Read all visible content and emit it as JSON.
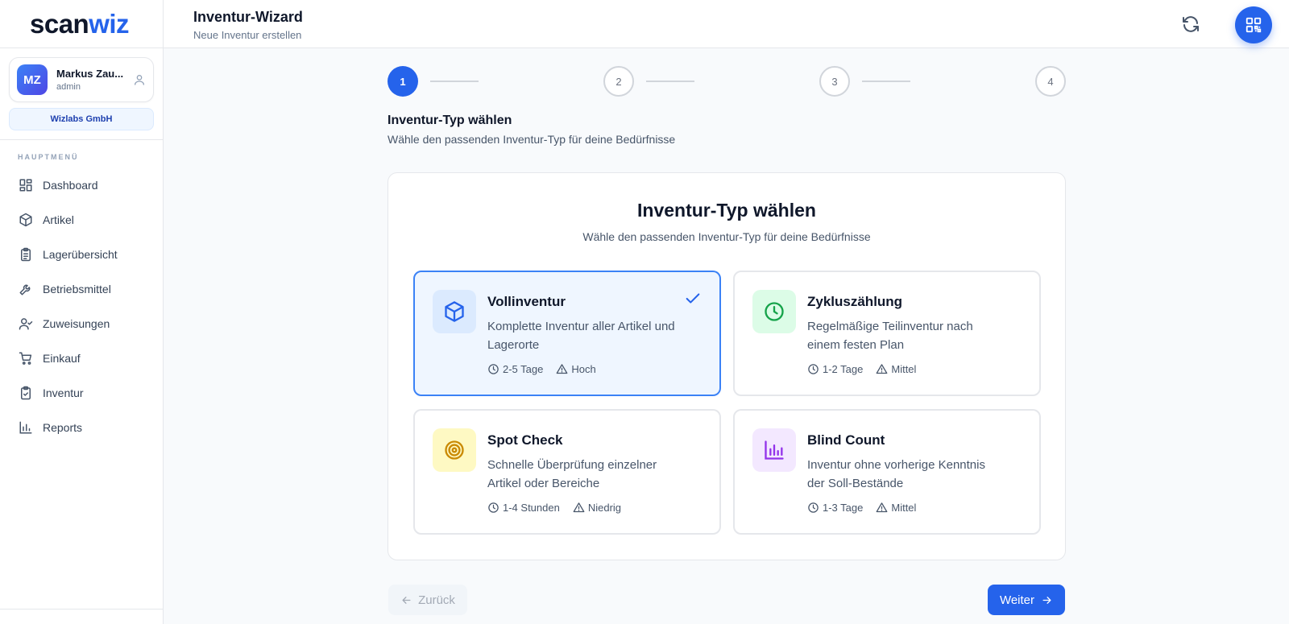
{
  "brand": {
    "logo_part1": "scan",
    "logo_part2": "wiz"
  },
  "user": {
    "initials": "MZ",
    "name": "Markus Zau...",
    "role": "admin",
    "company": "Wizlabs GmbH"
  },
  "sidebar": {
    "heading": "HAUPTMENÜ",
    "items": [
      {
        "label": "Dashboard",
        "icon": "dashboard-icon"
      },
      {
        "label": "Artikel",
        "icon": "package-icon"
      },
      {
        "label": "Lagerübersicht",
        "icon": "clipboard-list-icon"
      },
      {
        "label": "Betriebsmittel",
        "icon": "wrench-icon"
      },
      {
        "label": "Zuweisungen",
        "icon": "user-check-icon"
      },
      {
        "label": "Einkauf",
        "icon": "cart-icon"
      },
      {
        "label": "Inventur",
        "icon": "clipboard-check-icon"
      },
      {
        "label": "Reports",
        "icon": "bar-chart-icon"
      }
    ]
  },
  "header": {
    "title": "Inventur-Wizard",
    "subtitle": "Neue Inventur erstellen"
  },
  "stepper": {
    "steps": [
      "1",
      "2",
      "3",
      "4"
    ],
    "current": 1
  },
  "section": {
    "title": "Inventur-Typ wählen",
    "subtitle": "Wähle den passenden Inventur-Typ für deine Bedürfnisse"
  },
  "card": {
    "title": "Inventur-Typ wählen",
    "subtitle": "Wähle den passenden Inventur-Typ für deine Bedürfnisse",
    "options": [
      {
        "title": "Vollinventur",
        "desc": "Komplette Inventur aller Artikel und Lagerorte",
        "duration": "2-5 Tage",
        "effort": "Hoch",
        "icon": "package-icon",
        "color": "#2563eb",
        "bg": "#dbeafe",
        "selected": true
      },
      {
        "title": "Zykluszählung",
        "desc": "Regelmäßige Teilinventur nach einem festen Plan",
        "duration": "1-2 Tage",
        "effort": "Mittel",
        "icon": "clock-icon",
        "color": "#16a34a",
        "bg": "#dcfce7",
        "selected": false
      },
      {
        "title": "Spot Check",
        "desc": "Schnelle Überprüfung einzelner Artikel oder Bereiche",
        "duration": "1-4 Stunden",
        "effort": "Niedrig",
        "icon": "target-icon",
        "color": "#ca8a04",
        "bg": "#fef9c3",
        "selected": false
      },
      {
        "title": "Blind Count",
        "desc": "Inventur ohne vorherige Kenntnis der Soll-Bestände",
        "duration": "1-3 Tage",
        "effort": "Mittel",
        "icon": "bar-chart-icon",
        "color": "#9333ea",
        "bg": "#f3e8ff",
        "selected": false
      }
    ]
  },
  "footer": {
    "back_label": "Zurück",
    "next_label": "Weiter"
  },
  "colors": {
    "accent": "#2563eb",
    "selected_bg": "#eff6ff"
  }
}
